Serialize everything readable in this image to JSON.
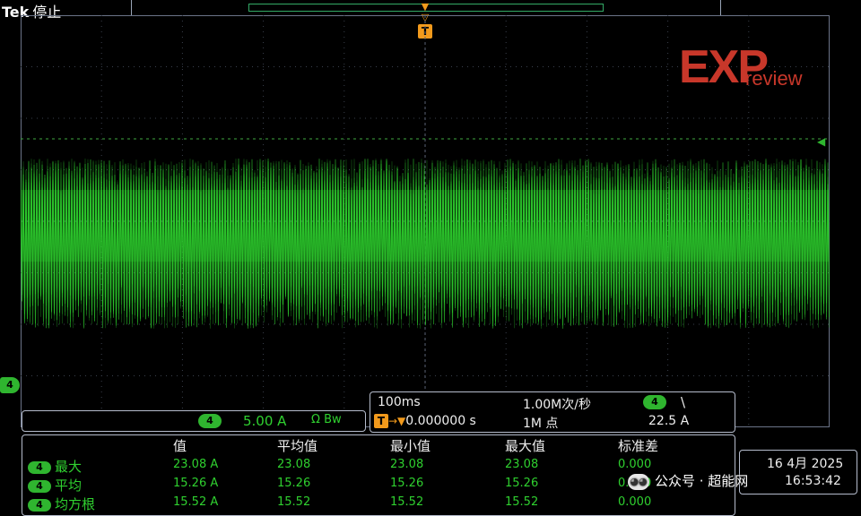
{
  "header": {
    "brand": "Tek",
    "status": "停止"
  },
  "logo": {
    "main": "EXP",
    "sub": "review"
  },
  "trigger": {
    "marker": "T"
  },
  "channel": {
    "marker": "4",
    "scale": "5.00 A",
    "extra": "Ω Bw"
  },
  "horizontal": {
    "time_scale": "100ms",
    "sample_rate": "1.00M次/秒",
    "trig_channel": "4",
    "trig_slope": "\\",
    "position": "0.000000 s",
    "record_length": "1M 点",
    "trig_level": "22.5 A"
  },
  "measurements": {
    "headers": [
      "值",
      "平均值",
      "最小值",
      "最大值",
      "标准差"
    ],
    "rows": [
      {
        "chip": "4",
        "label": "最大",
        "values": [
          "23.08 A",
          "23.08",
          "23.08",
          "23.08",
          "0.000"
        ]
      },
      {
        "chip": "4",
        "label": "平均",
        "values": [
          "15.26 A",
          "15.26",
          "15.26",
          "15.26",
          "0.000"
        ]
      },
      {
        "chip": "4",
        "label": "均方根",
        "values": [
          "15.52 A",
          "15.52",
          "15.52",
          "15.52",
          "0.000"
        ]
      }
    ]
  },
  "datetime": {
    "date": "16 4月 2025",
    "time": "16:53:42"
  },
  "watermark": {
    "icon": "wechat-icon",
    "text": "公众号 · 超能网"
  },
  "colors": {
    "trace": "#2fd02f",
    "trigger": "#f29a1c",
    "logo": "#c8372a"
  }
}
